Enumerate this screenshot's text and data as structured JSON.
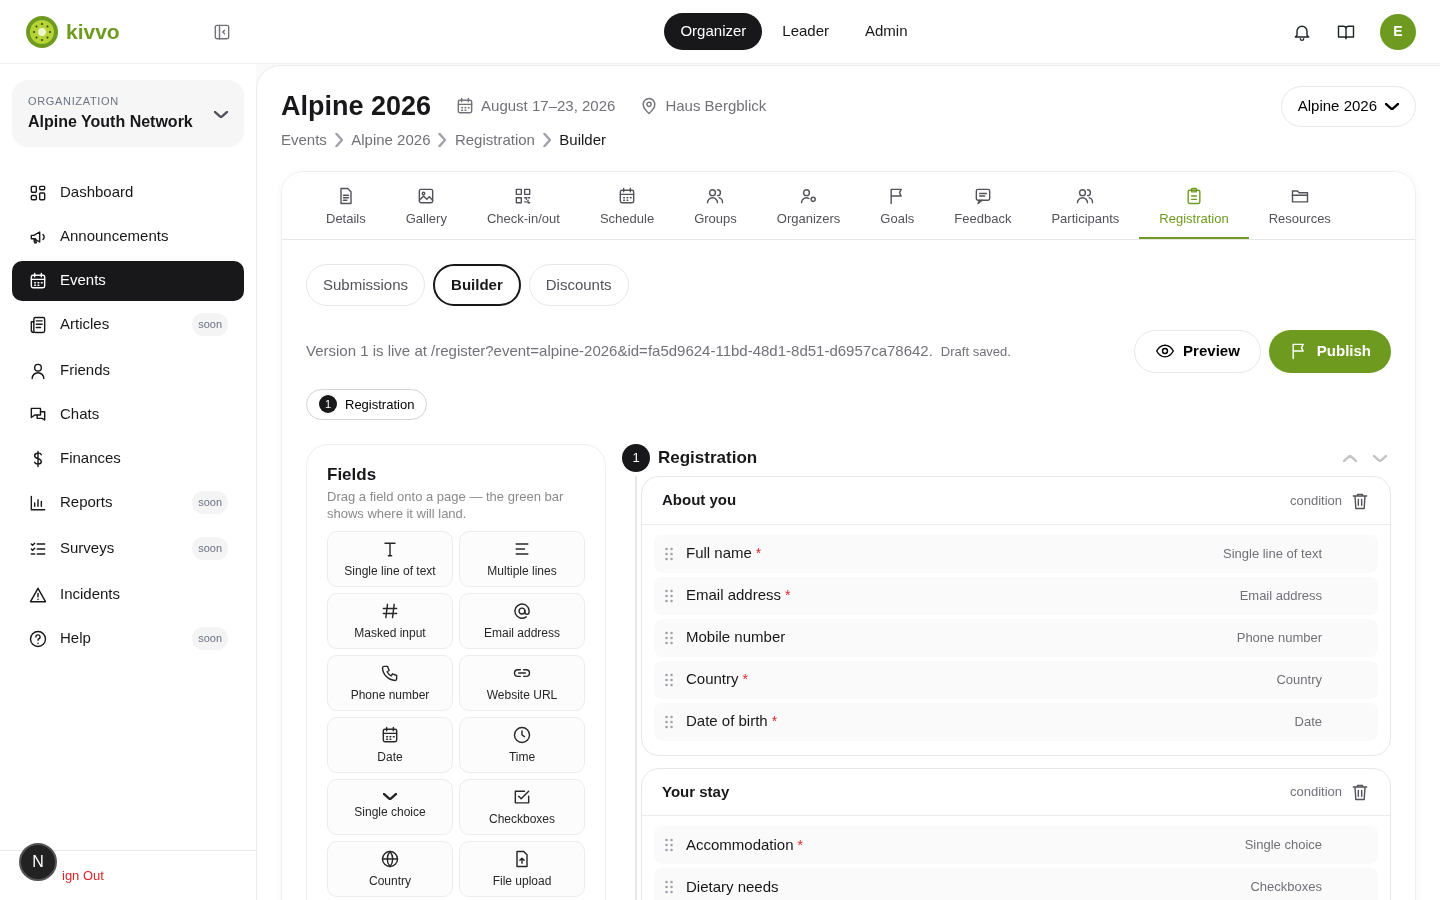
{
  "app": {
    "logo": "kivvo"
  },
  "top_nav": [
    {
      "label": "Organizer",
      "selected": true
    },
    {
      "label": "Leader",
      "selected": false
    },
    {
      "label": "Admin",
      "selected": false
    }
  ],
  "user": {
    "initial": "E"
  },
  "organization": {
    "caption": "ORGANIZATION",
    "name": "Alpine Youth Network"
  },
  "sidebar": {
    "items": [
      {
        "label": "Dashboard",
        "selected": false
      },
      {
        "label": "Announcements",
        "selected": false
      },
      {
        "label": "Events",
        "selected": true
      },
      {
        "label": "Articles",
        "selected": false,
        "badge": "soon"
      },
      {
        "label": "Friends",
        "selected": false
      },
      {
        "label": "Chats",
        "selected": false
      },
      {
        "label": "Finances",
        "selected": false
      },
      {
        "label": "Reports",
        "selected": false,
        "badge": "soon"
      },
      {
        "label": "Surveys",
        "selected": false,
        "badge": "soon"
      },
      {
        "label": "Incidents",
        "selected": false
      },
      {
        "label": "Help",
        "selected": false,
        "badge": "soon"
      }
    ]
  },
  "sign_out": "ign Out",
  "dev_badge": "N",
  "event": {
    "title": "Alpine 2026",
    "dates": "August 17–23, 2026",
    "venue": "Haus Bergblick",
    "switcher": "Alpine 2026"
  },
  "breadcrumb": [
    "Events",
    "Alpine 2026",
    "Registration",
    "Builder"
  ],
  "tabs": [
    {
      "label": "Details",
      "selected": false
    },
    {
      "label": "Gallery",
      "selected": false
    },
    {
      "label": "Check-in/out",
      "selected": false
    },
    {
      "label": "Schedule",
      "selected": false
    },
    {
      "label": "Groups",
      "selected": false
    },
    {
      "label": "Organizers",
      "selected": false
    },
    {
      "label": "Goals",
      "selected": false
    },
    {
      "label": "Feedback",
      "selected": false
    },
    {
      "label": "Participants",
      "selected": false
    },
    {
      "label": "Registration",
      "selected": true
    },
    {
      "label": "Resources",
      "selected": false
    }
  ],
  "subtabs": [
    {
      "label": "Submissions",
      "selected": false
    },
    {
      "label": "Builder",
      "selected": true
    },
    {
      "label": "Discounts",
      "selected": false
    }
  ],
  "status": {
    "text": "Version 1 is live at /register?event=alpine-2026&id=fa5d9624-11bd-48d1-8d51-d6957ca78642.",
    "note": "Draft saved."
  },
  "actions": {
    "preview": "Preview",
    "publish": "Publish"
  },
  "pages": [
    {
      "number": "1",
      "label": "Registration",
      "selected": true
    }
  ],
  "fields_panel": {
    "title": "Fields",
    "hint": "Drag a field onto a page — the green bar shows where it will land.",
    "types": [
      "Single line of text",
      "Multiple lines",
      "Masked input",
      "Email address",
      "Phone number",
      "Website URL",
      "Date",
      "Time",
      "Single choice",
      "Checkboxes",
      "Country",
      "File upload"
    ]
  },
  "page": {
    "number": "1",
    "title": "Registration",
    "sections": [
      {
        "title": "About you",
        "condition": "condition",
        "fields": [
          {
            "label": "Full name",
            "required_mark": "*",
            "type": "Single line of text"
          },
          {
            "label": "Email address",
            "required_mark": "*",
            "type": "Email address"
          },
          {
            "label": "Mobile number",
            "type": "Phone number"
          },
          {
            "label": "Country",
            "required_mark": "*",
            "type": "Country"
          },
          {
            "label": "Date of birth",
            "required_mark": "*",
            "type": "Date"
          }
        ]
      },
      {
        "title": "Your stay",
        "condition": "condition",
        "fields": [
          {
            "label": "Accommodation",
            "required_mark": "*",
            "type": "Single choice"
          },
          {
            "label": "Dietary needs",
            "type": "Checkboxes"
          }
        ]
      }
    ]
  }
}
